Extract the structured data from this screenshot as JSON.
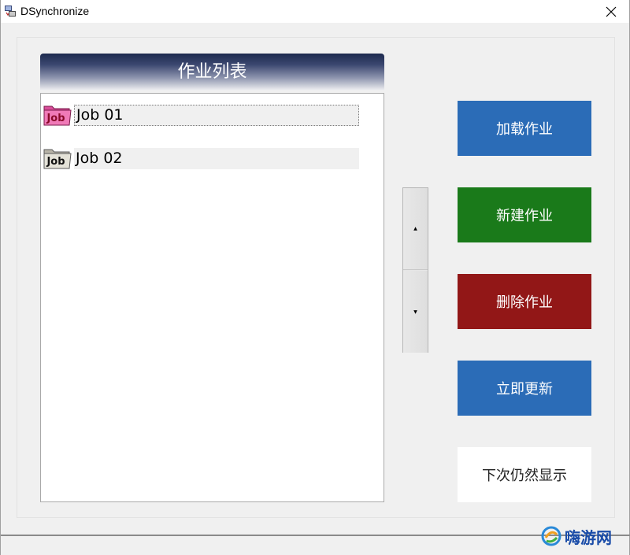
{
  "window": {
    "title": "DSynchronize"
  },
  "job_list": {
    "header": "作业列表",
    "items": [
      {
        "label": "Job 01",
        "icon": "job-folder-pink-icon",
        "selected": true
      },
      {
        "label": "Job 02",
        "icon": "job-folder-gray-icon",
        "selected": false
      }
    ]
  },
  "buttons": {
    "load_job": "加载作业",
    "new_job": "新建作业",
    "delete_job": "删除作业",
    "update_now": "立即更新",
    "show_next_time": "下次仍然显示"
  },
  "colors": {
    "load": "#2b6cb7",
    "new": "#1a7a1a",
    "delete": "#921717",
    "update": "#2b6cb7",
    "show": "#ffffff",
    "watermark": "#1a4ca8"
  },
  "watermark": {
    "text": "嗨游网"
  }
}
